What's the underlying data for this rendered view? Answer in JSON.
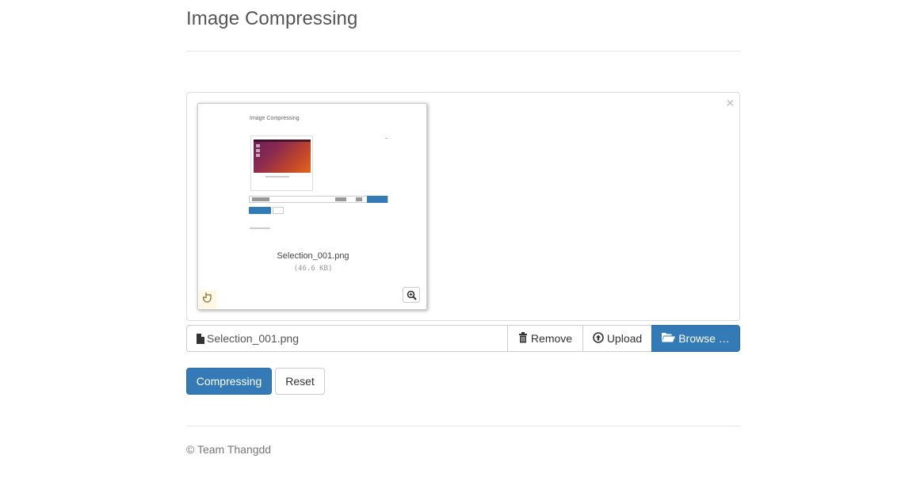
{
  "header": {
    "title": "Image Compressing"
  },
  "preview": {
    "close_glyph": "×",
    "thumbnail": {
      "caption": "Selection_001.png",
      "size": "(46.6 KB)",
      "inner_title": "Image Compressing",
      "drag_icon": "hand-drag-icon",
      "zoom_icon": "zoom-in-icon"
    }
  },
  "file_input": {
    "caption": "Selection_001.png",
    "file_icon": "file-icon",
    "remove_label": "Remove",
    "remove_icon": "trash-icon",
    "upload_label": "Upload",
    "upload_icon": "upload-circle-icon",
    "browse_label": "Browse …",
    "browse_icon": "folder-open-icon"
  },
  "actions": {
    "compress_label": "Compressing",
    "reset_label": "Reset"
  },
  "footer": {
    "text": "© Team Thangdd"
  },
  "colors": {
    "primary": "#337ab7",
    "border": "#cccccc",
    "muted": "#777777"
  }
}
